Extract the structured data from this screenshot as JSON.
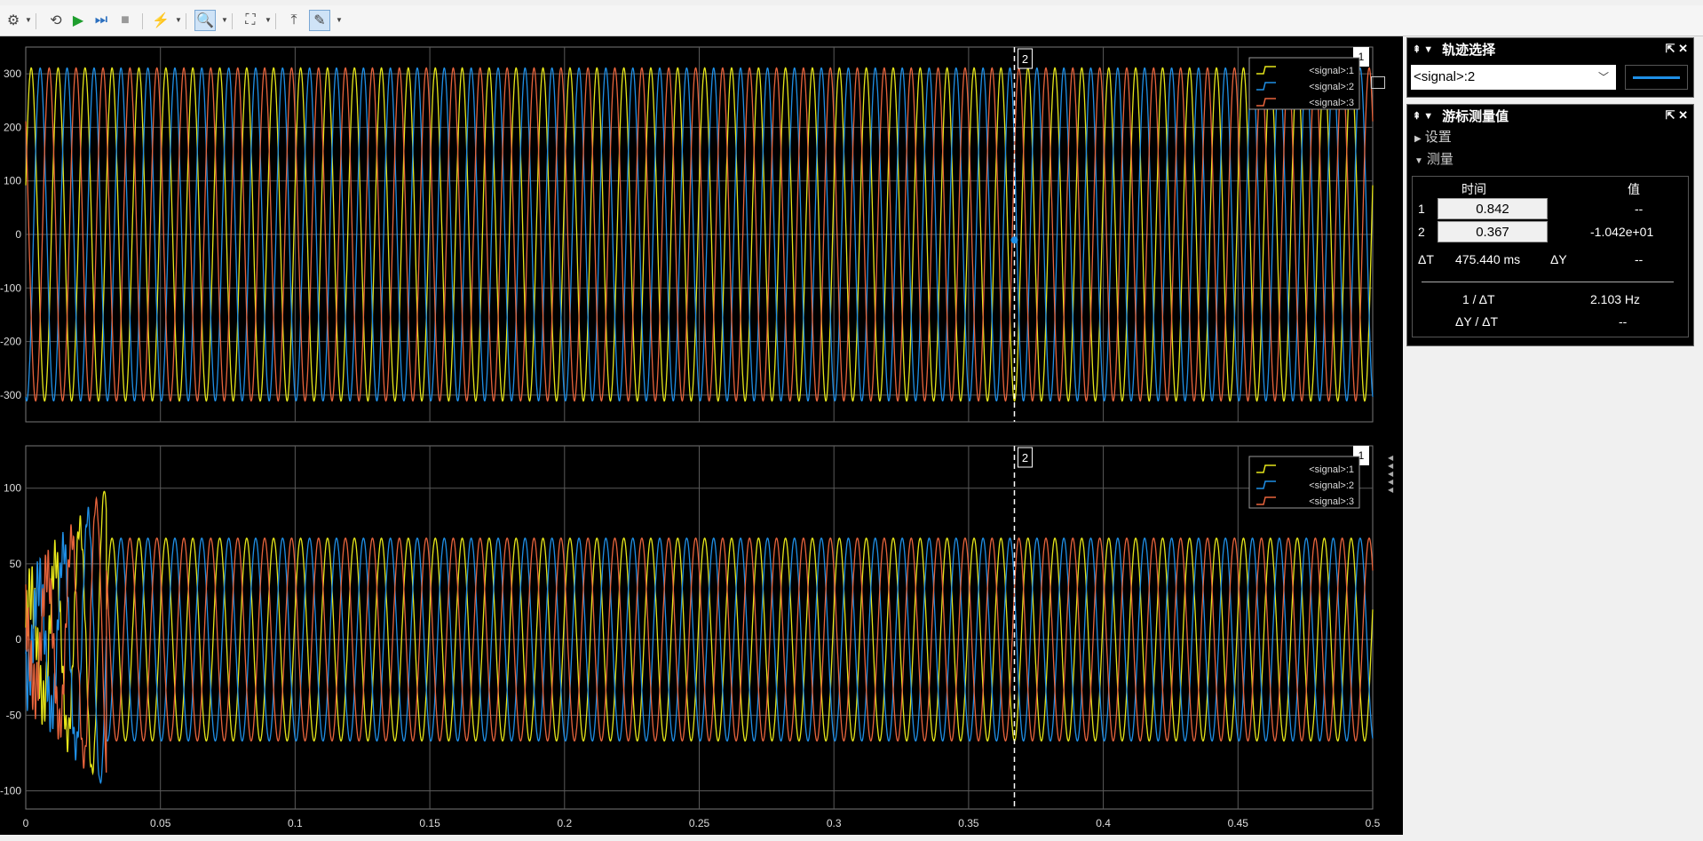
{
  "toolbar": {
    "items": [
      "gear-icon",
      "undo-step-icon",
      "run-icon",
      "step-forward-icon",
      "stop-icon",
      "highlight-icon",
      "zoom-in-icon",
      "fit-to-view-icon",
      "triggers-icon",
      "cursor-measurements-icon"
    ]
  },
  "colors": {
    "signal1": "#e6e61a",
    "signal2": "#1f8fe6",
    "signal3": "#e8643c",
    "grid": "#5a5a5a"
  },
  "chart_data": [
    {
      "type": "line",
      "ylim": [
        -350,
        350
      ],
      "xlim": [
        0,
        0.5
      ],
      "yticks": [
        "300",
        "200",
        "100",
        "0",
        "-100",
        "-200",
        "-300"
      ],
      "yvals": [
        300,
        200,
        100,
        0,
        -100,
        -200,
        -300
      ],
      "legend": [
        "<signal>:1",
        "<signal>:2",
        "<signal>:3"
      ],
      "legend_position": "top-right",
      "amplitude": 311,
      "frequency_hz": 100,
      "cursor_x": 0.367,
      "cursor_label": "2",
      "grid": true
    },
    {
      "type": "line",
      "ylim": [
        -112,
        128
      ],
      "xlim": [
        0,
        0.5
      ],
      "yticks": [
        "100",
        "50",
        "0",
        "-50",
        "-100"
      ],
      "yvals": [
        100,
        50,
        0,
        -50,
        -100
      ],
      "xticks": [
        "0",
        "0.05",
        "0.1",
        "0.15",
        "0.2",
        "0.25",
        "0.3",
        "0.35",
        "0.4",
        "0.45",
        "0.5"
      ],
      "xvals": [
        0,
        0.05,
        0.1,
        0.15,
        0.2,
        0.25,
        0.3,
        0.35,
        0.4,
        0.45,
        0.5
      ],
      "legend": [
        "<signal>:1",
        "<signal>:2",
        "<signal>:3"
      ],
      "legend_position": "top-right",
      "amplitude": 67,
      "frequency_hz": 100,
      "transient_end": 0.03,
      "cursor_x": 0.367,
      "cursor_label": "2",
      "grid": true
    }
  ],
  "trace_panel": {
    "title": "轨迹选择",
    "selected": "<signal>:2"
  },
  "cursor_panel": {
    "title": "游标测量值",
    "settings_label": "设置",
    "measure_label": "测量",
    "col_time": "时间",
    "col_value": "值",
    "row1_label": "1",
    "row1_time": "0.842",
    "row1_value": "--",
    "row2_label": "2",
    "row2_time": "0.367",
    "row2_value": "-1.042e+01",
    "dt_label": "ΔT",
    "dt_value": "475.440 ms",
    "dy_label": "ΔY",
    "dy_value": "--",
    "inv_dt_label": "1 / ΔT",
    "inv_dt_value": "2.103 Hz",
    "dydt_label": "ΔY / ΔT",
    "dydt_value": "--"
  }
}
